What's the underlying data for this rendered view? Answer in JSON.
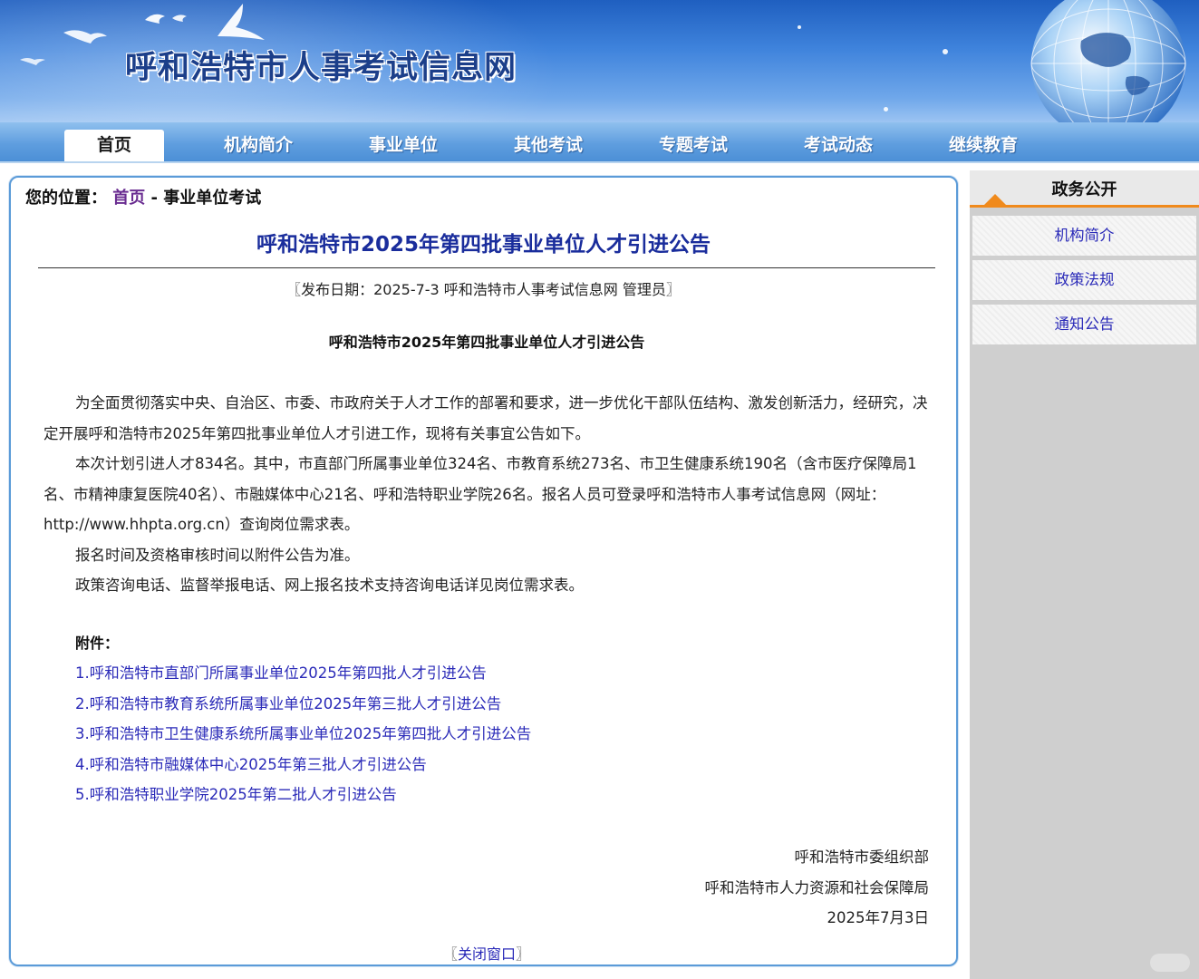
{
  "site": {
    "title": "呼和浩特市人事考试信息网"
  },
  "nav": {
    "items": [
      {
        "label": "首页",
        "active": true
      },
      {
        "label": "机构简介"
      },
      {
        "label": "事业单位"
      },
      {
        "label": "其他考试"
      },
      {
        "label": "专题考试"
      },
      {
        "label": "考试动态"
      },
      {
        "label": "继续教育"
      }
    ]
  },
  "breadcrumb": {
    "prefix": "您的位置：",
    "home": "首页",
    "sep": " - ",
    "current": "事业单位考试"
  },
  "article": {
    "headline": "呼和浩特市2025年第四批事业单位人才引进公告",
    "meta": "〖发布日期：2025-7-3 呼和浩特市人事考试信息网 管理员〗",
    "subtitle": "呼和浩特市2025年第四批事业单位人才引进公告",
    "paragraphs": [
      "为全面贯彻落实中央、自治区、市委、市政府关于人才工作的部署和要求，进一步优化干部队伍结构、激发创新活力，经研究，决定开展呼和浩特市2025年第四批事业单位人才引进工作，现将有关事宜公告如下。",
      "本次计划引进人才834名。其中，市直部门所属事业单位324名、市教育系统273名、市卫生健康系统190名（含市医疗保障局1名、市精神康复医院40名）、市融媒体中心21名、呼和浩特职业学院26名。报名人员可登录呼和浩特市人事考试信息网（网址：http://www.hhpta.org.cn）查询岗位需求表。",
      "报名时间及资格审核时间以附件公告为准。",
      "政策咨询电话、监督举报电话、网上报名技术支持咨询电话详见岗位需求表。"
    ],
    "attachments_label": "附件：",
    "attachments": [
      "1.呼和浩特市直部门所属事业单位2025年第四批人才引进公告",
      "2.呼和浩特市教育系统所属事业单位2025年第三批人才引进公告",
      "3.呼和浩特市卫生健康系统所属事业单位2025年第四批人才引进公告",
      "4.呼和浩特市融媒体中心2025年第三批人才引进公告",
      "5.呼和浩特职业学院2025年第二批人才引进公告"
    ],
    "signature": [
      "呼和浩特市委组织部",
      "呼和浩特市人力资源和社会保障局",
      "2025年7月3日"
    ],
    "close": {
      "open": "〖",
      "label": "关闭窗口",
      "close": "〗"
    }
  },
  "sidebar": {
    "title": "政务公开",
    "accent": "#f08a1c",
    "items": [
      "机构简介",
      "政策法规",
      "通知公告"
    ]
  },
  "colors": {
    "link": "#2a2ab8",
    "headline": "#1a2d9c",
    "border": "#5b9bd8"
  }
}
